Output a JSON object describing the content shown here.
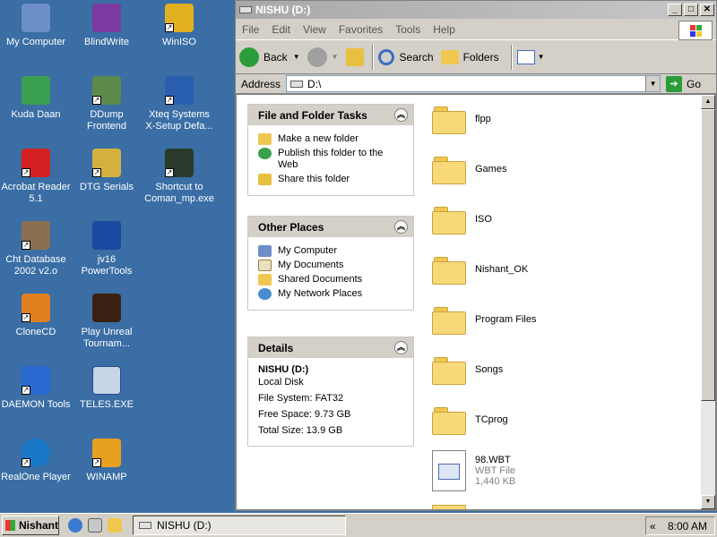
{
  "desktop": {
    "icons": [
      {
        "label": "My Computer",
        "icon": "my-computer-icon",
        "color": "#6c8fc7"
      },
      {
        "label": "BlindWrite",
        "icon": "blindwrite-icon",
        "color": "#7a3aa0"
      },
      {
        "label": "WinISO",
        "icon": "winiso-icon",
        "color": "#e2b020"
      },
      {
        "label": "Kuda Daan",
        "icon": "recycle-bin-icon",
        "color": "#3aa050"
      },
      {
        "label": "DDump Frontend",
        "icon": "ddump-icon",
        "color": "#5c8a4a"
      },
      {
        "label": "Xteq Systems X-Setup Defa...",
        "icon": "xsetup-icon",
        "color": "#2a5fb0"
      },
      {
        "label": "Acrobat Reader 5.1",
        "icon": "acrobat-icon",
        "color": "#d42020"
      },
      {
        "label": "DTG Serials",
        "icon": "key-icon",
        "color": "#d4b040"
      },
      {
        "label": "Shortcut to Coman_mp.exe",
        "icon": "grenade-icon",
        "color": "#2a3a2a"
      },
      {
        "label": "Cht Database 2002 v2.o",
        "icon": "database-icon",
        "color": "#8a7050"
      },
      {
        "label": "jv16 PowerTools",
        "icon": "bulb-icon",
        "color": "#1a4aa0"
      },
      {
        "label": "CloneCD",
        "icon": "clonecd-icon",
        "color": "#e08020"
      },
      {
        "label": "Play Unreal Tournam...",
        "icon": "unreal-icon",
        "color": "#3a2010"
      },
      {
        "label": "DAEMON Tools",
        "icon": "daemon-tools-icon",
        "color": "#2a6ad0"
      },
      {
        "label": "TELES.EXE",
        "icon": "app-window-icon",
        "color": "#c8d4e8"
      },
      {
        "label": "RealOne Player",
        "icon": "realone-icon",
        "color": "#1a78c8"
      },
      {
        "label": "WINAMP",
        "icon": "winamp-icon",
        "color": "#e8a020"
      }
    ]
  },
  "window": {
    "title": "NISHU (D:)",
    "menu": [
      "File",
      "Edit",
      "View",
      "Favorites",
      "Tools",
      "Help"
    ],
    "toolbar": {
      "back": "Back",
      "search": "Search",
      "folders": "Folders"
    },
    "address": {
      "label": "Address",
      "value": "D:\\",
      "go": "Go"
    },
    "tasks_panel": {
      "title": "File and Folder Tasks",
      "items": [
        "Make a new folder",
        "Publish this folder to the Web",
        "Share this folder"
      ]
    },
    "places_panel": {
      "title": "Other Places",
      "items": [
        "My Computer",
        "My Documents",
        "Shared Documents",
        "My Network Places"
      ]
    },
    "details_panel": {
      "title": "Details",
      "name": "NISHU (D:)",
      "type": "Local Disk",
      "filesystem": "File System: FAT32",
      "free": "Free Space: 9.73 GB",
      "total": "Total Size: 13.9 GB"
    },
    "files": [
      {
        "name": "flpp",
        "kind": "folder"
      },
      {
        "name": "Games",
        "kind": "folder"
      },
      {
        "name": "ISO",
        "kind": "folder"
      },
      {
        "name": "Nishant_OK",
        "kind": "folder"
      },
      {
        "name": "Program Files",
        "kind": "folder"
      },
      {
        "name": "Songs",
        "kind": "folder"
      },
      {
        "name": "TCprog",
        "kind": "folder"
      },
      {
        "name": "98.WBT",
        "kind": "file",
        "type": "WBT File",
        "size": "1,440 KB"
      }
    ]
  },
  "taskbar": {
    "start": "Nishant",
    "task": "NISHU (D:)",
    "clock": "8:00 AM",
    "tray_toggle": "«"
  }
}
